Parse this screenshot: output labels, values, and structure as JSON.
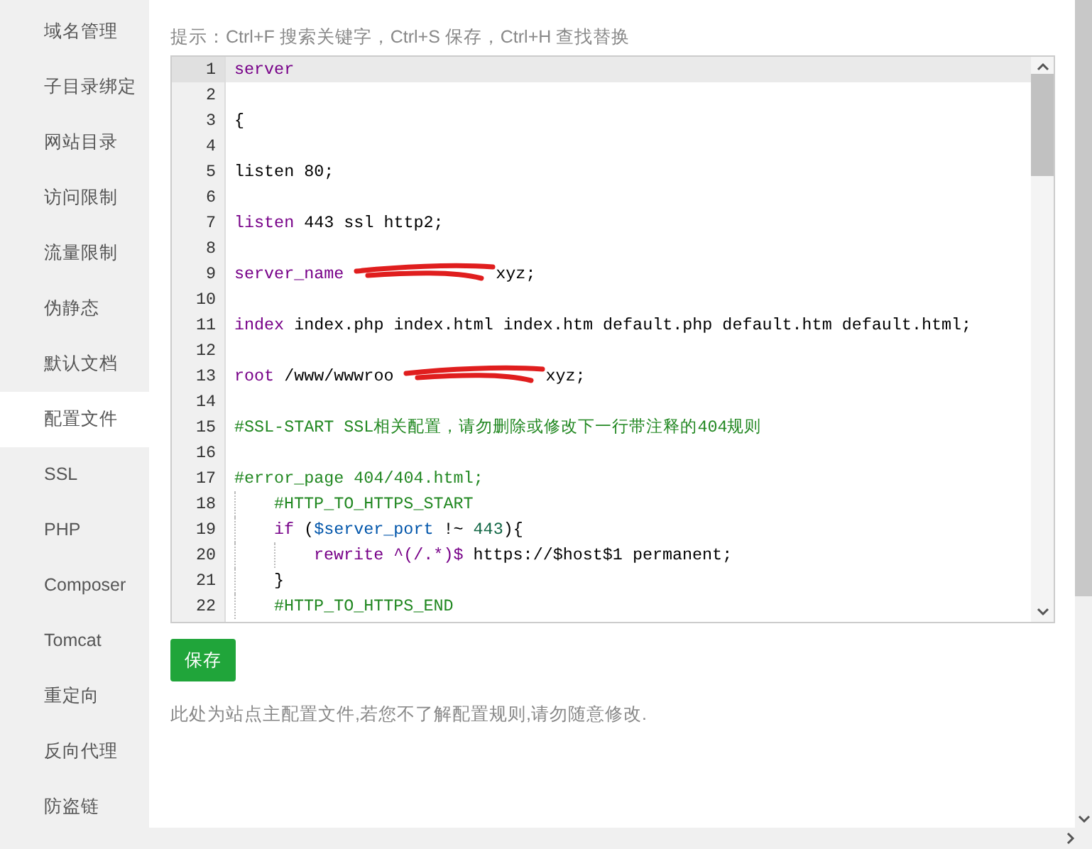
{
  "sidebar": {
    "items": [
      {
        "label": "域名管理",
        "selected": false
      },
      {
        "label": "子目录绑定",
        "selected": false
      },
      {
        "label": "网站目录",
        "selected": false
      },
      {
        "label": "访问限制",
        "selected": false
      },
      {
        "label": "流量限制",
        "selected": false
      },
      {
        "label": "伪静态",
        "selected": false
      },
      {
        "label": "默认文档",
        "selected": false
      },
      {
        "label": "配置文件",
        "selected": true
      },
      {
        "label": "SSL",
        "selected": false
      },
      {
        "label": "PHP",
        "selected": false
      },
      {
        "label": "Composer",
        "selected": false
      },
      {
        "label": "Tomcat",
        "selected": false
      },
      {
        "label": "重定向",
        "selected": false
      },
      {
        "label": "反向代理",
        "selected": false
      },
      {
        "label": "防盗链",
        "selected": false
      }
    ]
  },
  "hint": "提示：Ctrl+F 搜索关键字，Ctrl+S 保存，Ctrl+H 查找替换",
  "editor": {
    "lines": [
      {
        "number": "1",
        "active": true,
        "tokens": [
          {
            "kind": "keyword",
            "text": "server"
          }
        ]
      },
      {
        "number": "2",
        "active": false
      },
      {
        "number": "3",
        "active": false,
        "tokens": [
          {
            "kind": "plain",
            "text": "{"
          }
        ]
      },
      {
        "number": "4",
        "active": false
      },
      {
        "number": "5",
        "active": false,
        "tokens": [
          {
            "kind": "plain",
            "text": "listen 80;"
          }
        ]
      },
      {
        "number": "6",
        "active": false
      },
      {
        "number": "7",
        "active": false,
        "tokens": [
          {
            "kind": "keyword",
            "text": "listen"
          },
          {
            "kind": "plain",
            "text": " 443 ssl http2;"
          }
        ]
      },
      {
        "number": "8",
        "active": false
      },
      {
        "number": "9",
        "active": false,
        "tokens": [
          {
            "kind": "keyword",
            "text": "server_name"
          },
          {
            "kind": "redacted"
          },
          {
            "kind": "plain",
            "text": "xyz;"
          }
        ]
      },
      {
        "number": "10",
        "active": false
      },
      {
        "number": "11",
        "active": false,
        "tokens": [
          {
            "kind": "keyword",
            "text": "index"
          },
          {
            "kind": "plain",
            "text": " index.php index.html index.htm default.php default.htm default.html;"
          }
        ]
      },
      {
        "number": "12",
        "active": false
      },
      {
        "number": "13",
        "active": false,
        "tokens": [
          {
            "kind": "keyword",
            "text": "root"
          },
          {
            "kind": "plain",
            "text": " /www/wwwroo"
          },
          {
            "kind": "redacted"
          },
          {
            "kind": "plain",
            "text": "xyz;"
          }
        ]
      },
      {
        "number": "14",
        "active": false
      },
      {
        "number": "15",
        "active": false,
        "tokens": [
          {
            "kind": "comment",
            "text": "#SSL-START SSL相关配置，请勿删除或修改下一行带注释的404规则"
          }
        ]
      },
      {
        "number": "16",
        "active": false
      },
      {
        "number": "17",
        "active": false,
        "tokens": [
          {
            "kind": "comment",
            "text": "#error_page 404/404.html;"
          }
        ]
      },
      {
        "number": "18",
        "active": false,
        "tokens": [
          {
            "kind": "indent"
          },
          {
            "kind": "comment",
            "text": "#HTTP_TO_HTTPS_START"
          }
        ]
      },
      {
        "number": "19",
        "active": false,
        "tokens": [
          {
            "kind": "indent"
          },
          {
            "kind": "keyword",
            "text": "if"
          },
          {
            "kind": "plain",
            "text": " ("
          },
          {
            "kind": "variable",
            "text": "$server_port"
          },
          {
            "kind": "plain",
            "text": " !~ "
          },
          {
            "kind": "number",
            "text": "443"
          },
          {
            "kind": "plain",
            "text": "){"
          }
        ]
      },
      {
        "number": "20",
        "active": false,
        "tokens": [
          {
            "kind": "indent"
          },
          {
            "kind": "indent"
          },
          {
            "kind": "keyword",
            "text": "rewrite"
          },
          {
            "kind": "keyword",
            "text": " ^(/.*)$"
          },
          {
            "kind": "plain",
            "text": " https://$host$1 permanent;"
          }
        ]
      },
      {
        "number": "21",
        "active": false,
        "tokens": [
          {
            "kind": "indent"
          },
          {
            "kind": "plain",
            "text": "}"
          }
        ]
      },
      {
        "number": "22",
        "active": false,
        "tokens": [
          {
            "kind": "indent"
          },
          {
            "kind": "comment",
            "text": "#HTTP_TO_HTTPS_END"
          }
        ]
      }
    ]
  },
  "save_button": "保存",
  "note": "此处为站点主配置文件,若您不了解配置规则,请勿随意修改."
}
